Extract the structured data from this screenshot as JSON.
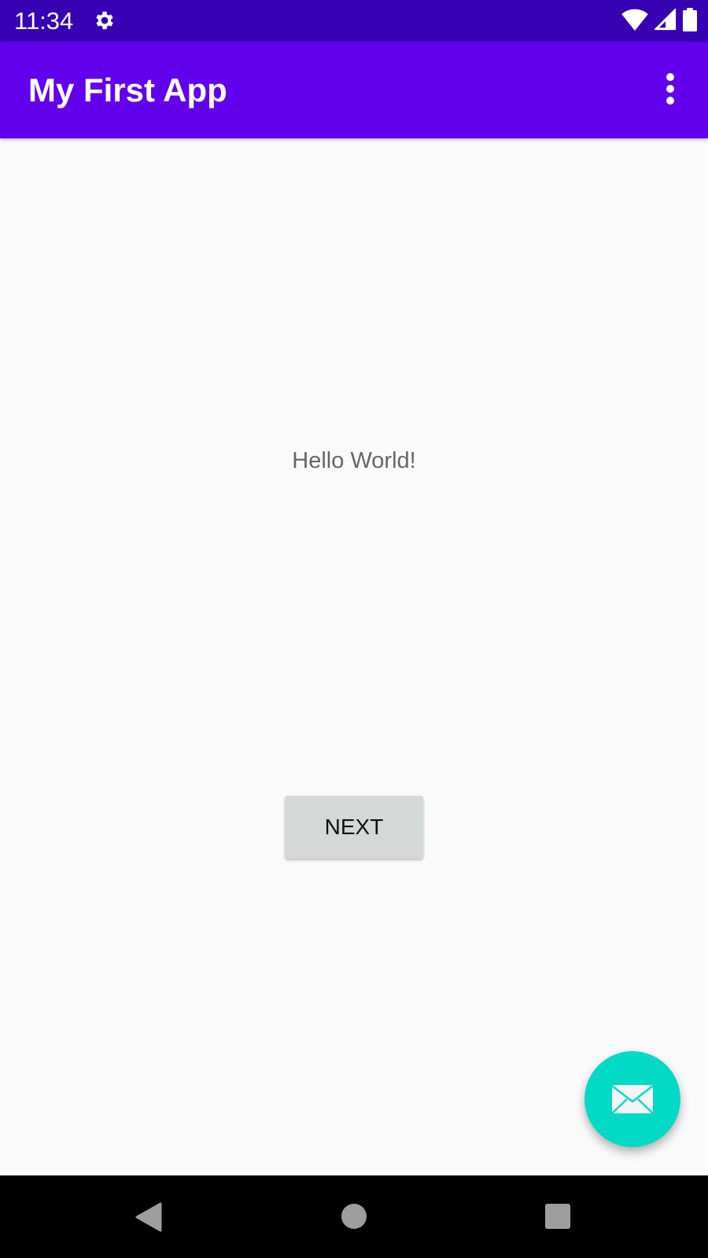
{
  "status_bar": {
    "time": "11:34"
  },
  "app_bar": {
    "title": "My First App"
  },
  "main": {
    "text": "Hello World!",
    "next_label": "NEXT"
  },
  "colors": {
    "primary": "#6200ee",
    "primary_dark": "#3700b3",
    "accent": "#03dac5"
  }
}
